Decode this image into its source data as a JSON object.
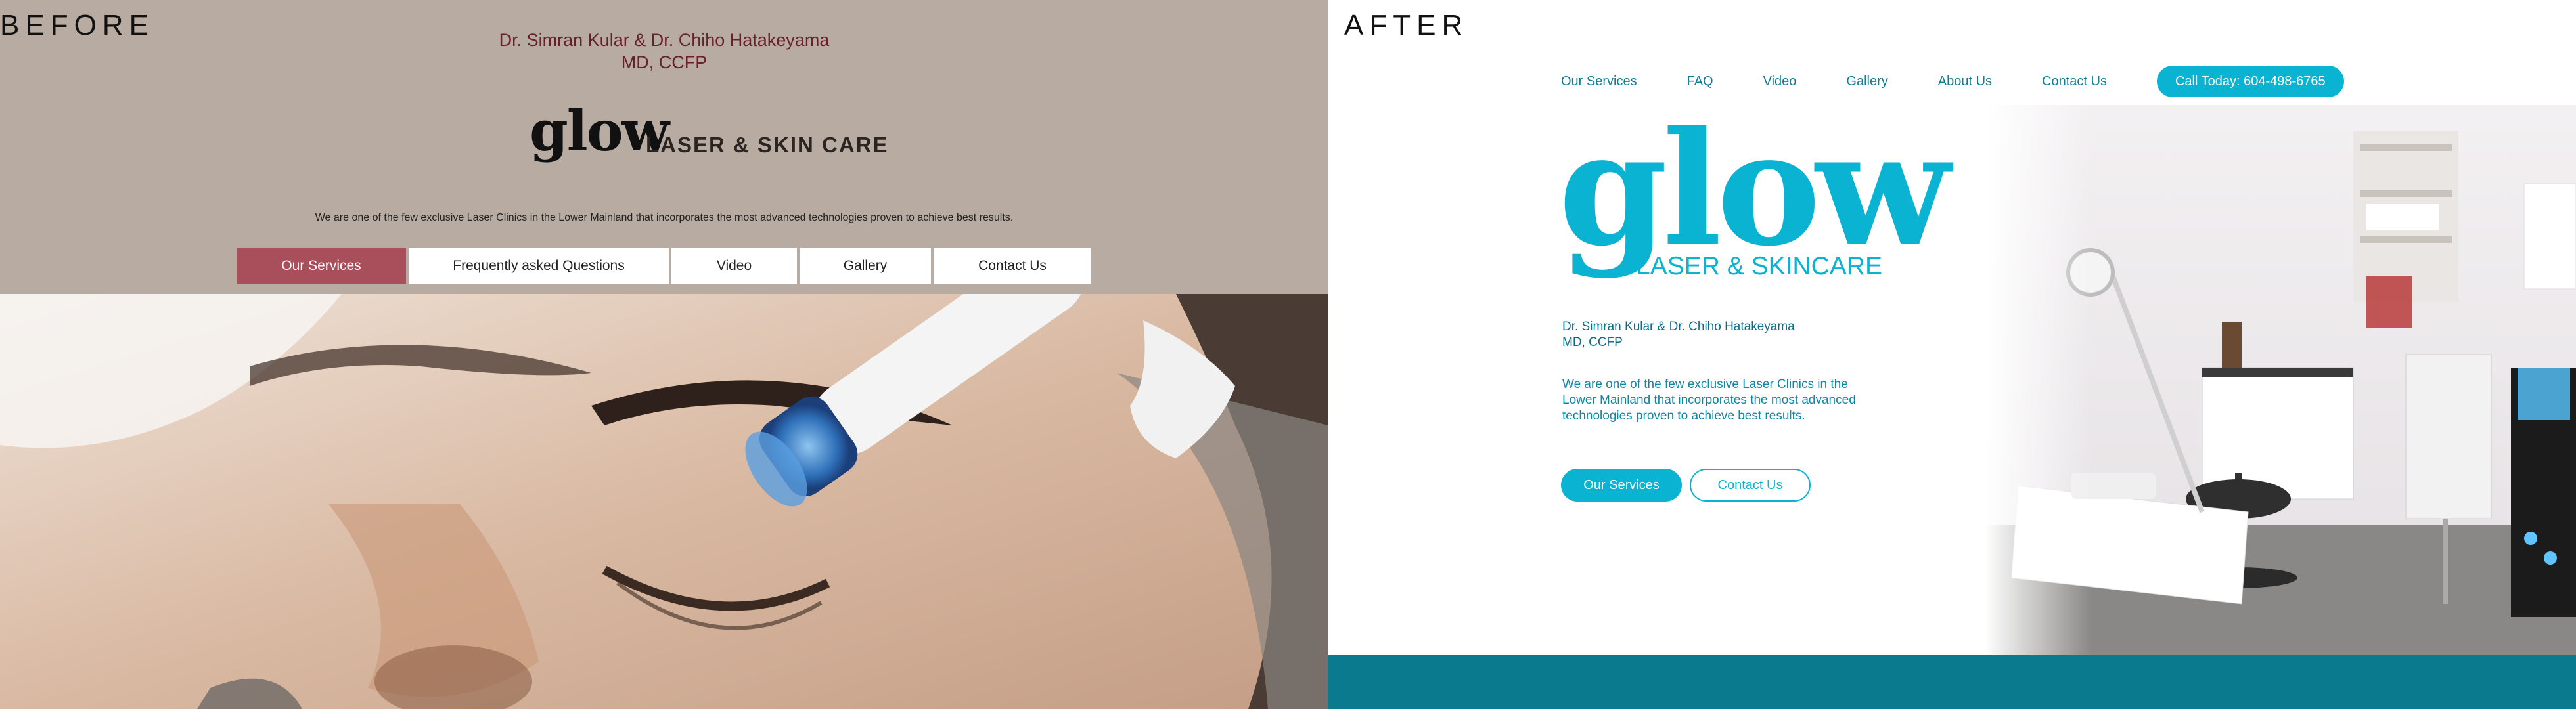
{
  "labels": {
    "before": "BEFORE",
    "after": "AFTER"
  },
  "before": {
    "doctors_line1": "Dr. Simran Kular & Dr. Chiho Hatakeyama",
    "doctors_line2": "MD, CCFP",
    "logo_word": "glow",
    "logo_sub": "LASER & SKIN CARE",
    "description": "We are one of the few exclusive Laser Clinics in the Lower Mainland that incorporates the most advanced technologies proven to achieve best results.",
    "nav": [
      {
        "label": "Our Services",
        "active": true
      },
      {
        "label": "Frequently asked Questions"
      },
      {
        "label": "Video"
      },
      {
        "label": "Gallery"
      },
      {
        "label": "Contact Us"
      }
    ]
  },
  "after": {
    "nav": [
      "Our Services",
      "FAQ",
      "Video",
      "Gallery",
      "About Us",
      "Contact Us"
    ],
    "call_button": "Call Today: 604-498-6765",
    "logo_word": "glow",
    "logo_sub": "LASER & SKINCARE",
    "doctors_line1": "Dr. Simran Kular & Dr. Chiho Hatakeyama",
    "doctors_line2": "MD, CCFP",
    "description": "We are one of the few exclusive Laser Clinics in the Lower Mainland that incorporates the most advanced technologies proven to achieve best results.",
    "primary_button": "Our Services",
    "secondary_button": "Contact Us"
  },
  "colors": {
    "before_header": "#b8aca2",
    "before_accent": "#a84f5b",
    "after_accent": "#0ab3d1",
    "after_band": "#0a7a8e"
  }
}
